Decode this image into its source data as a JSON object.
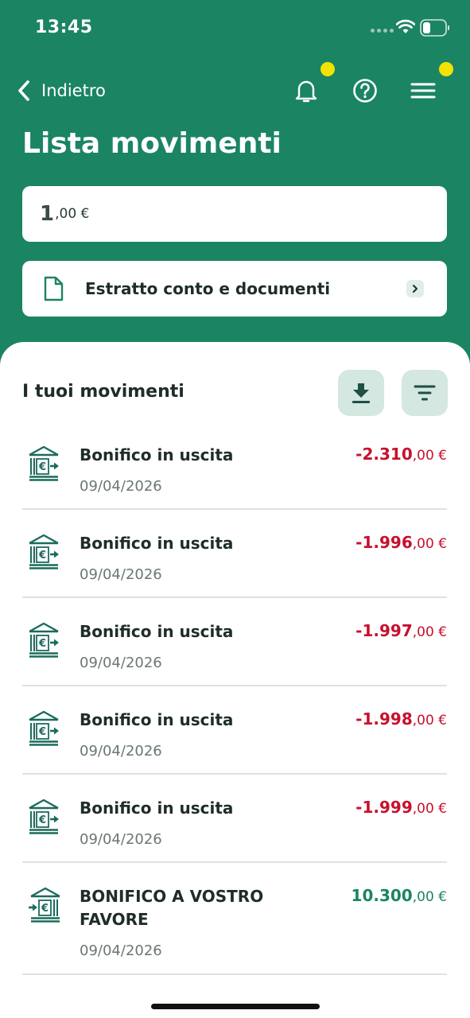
{
  "status_bar": {
    "time": "13:45"
  },
  "nav": {
    "back_label": "Indietro"
  },
  "header": {
    "title": "Lista movimenti"
  },
  "balance": {
    "integer": "1",
    "decimal": ",00 €"
  },
  "documents": {
    "label": "Estratto conto e documenti"
  },
  "movements": {
    "title": "I tuoi movimenti",
    "items": [
      {
        "title": "Bonifico in uscita",
        "date": "09/04/2026",
        "amount_int": "-2.310",
        "amount_dec": ",00 €",
        "direction": "out"
      },
      {
        "title": "Bonifico in uscita",
        "date": "09/04/2026",
        "amount_int": "-1.996",
        "amount_dec": ",00 €",
        "direction": "out"
      },
      {
        "title": "Bonifico in uscita",
        "date": "09/04/2026",
        "amount_int": "-1.997",
        "amount_dec": ",00 €",
        "direction": "out"
      },
      {
        "title": "Bonifico in uscita",
        "date": "09/04/2026",
        "amount_int": "-1.998",
        "amount_dec": ",00 €",
        "direction": "out"
      },
      {
        "title": "Bonifico in uscita",
        "date": "09/04/2026",
        "amount_int": "-1.999",
        "amount_dec": ",00 €",
        "direction": "out"
      },
      {
        "title": "BONIFICO A VOSTRO FAVORE",
        "date": "09/04/2026",
        "amount_int": "10.300",
        "amount_dec": ",00 €",
        "direction": "in"
      }
    ]
  },
  "icons": {
    "back": "chevron-left-icon",
    "notifications": "bell-icon",
    "help": "help-circle-icon",
    "menu": "hamburger-menu-icon",
    "document": "document-icon",
    "download": "download-icon",
    "filter": "filter-icon",
    "transfer_out": "bank-transfer-out-icon",
    "transfer_in": "bank-transfer-in-icon"
  },
  "colors": {
    "brand_green": "#1b8463",
    "negative": "#c8102e",
    "notification_dot": "#f2e205",
    "button_bg": "#d4e7e1"
  }
}
